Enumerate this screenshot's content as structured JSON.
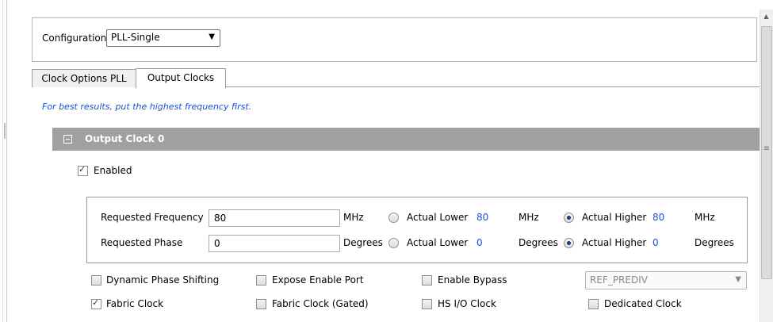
{
  "configuration": {
    "label": "Configuration",
    "value": "PLL-Single"
  },
  "tabs": [
    {
      "label": "Clock Options PLL",
      "active": false
    },
    {
      "label": "Output Clocks",
      "active": true
    }
  ],
  "hint": "For best results, put the highest frequency first.",
  "output_clock": {
    "title": "Output Clock 0",
    "enabled_label": "Enabled",
    "enabled": true,
    "frequency": {
      "label": "Requested Frequency",
      "value": "80",
      "unit": "MHz",
      "actual_lower_label": "Actual Lower",
      "actual_lower_value": "80",
      "actual_lower_unit": "MHz",
      "actual_higher_label": "Actual Higher",
      "actual_higher_value": "80",
      "actual_higher_unit": "MHz",
      "selected": "higher"
    },
    "phase": {
      "label": "Requested Phase",
      "value": "0",
      "unit": "Degrees",
      "actual_lower_label": "Actual Lower",
      "actual_lower_value": "0",
      "actual_lower_unit": "Degrees",
      "actual_higher_label": "Actual Higher",
      "actual_higher_value": "0",
      "actual_higher_unit": "Degrees",
      "selected": "higher"
    },
    "options": {
      "dynamic_phase_shifting": {
        "label": "Dynamic Phase Shifting",
        "checked": false
      },
      "expose_enable_port": {
        "label": "Expose Enable Port",
        "checked": false
      },
      "enable_bypass": {
        "label": "Enable Bypass",
        "checked": false
      },
      "bypass_source": {
        "value": "REF_PREDIV",
        "disabled": true
      },
      "fabric_clock": {
        "label": "Fabric Clock",
        "checked": true
      },
      "fabric_clock_gated": {
        "label": "Fabric Clock (Gated)",
        "checked": false
      },
      "hs_io_clock": {
        "label": "HS I/O Clock",
        "checked": false
      },
      "dedicated_clock": {
        "label": "Dedicated Clock",
        "checked": false
      }
    }
  },
  "icons": {
    "scroll_up": "chevron-up-icon",
    "collapse": "collapse-minus-icon",
    "dropdown": "chevron-down-icon"
  },
  "colors": {
    "group_header_bg": "#a0a0a0",
    "link_blue": "#1c4fcc",
    "value_blue": "#1a54cd"
  }
}
